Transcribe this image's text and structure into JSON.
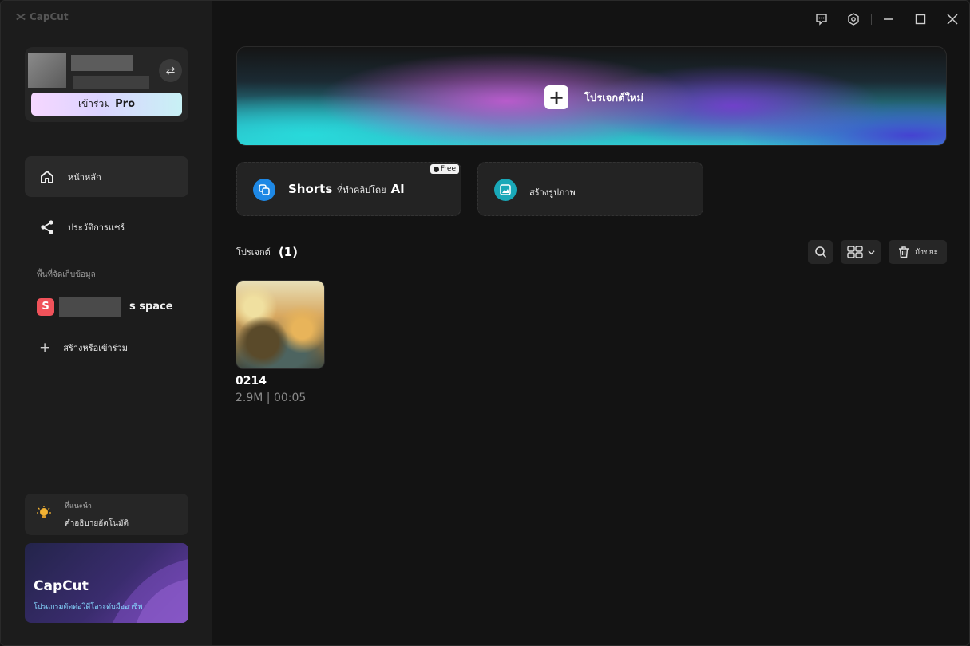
{
  "app": {
    "title": "CapCut"
  },
  "account": {
    "switch_icon": "swap-icon",
    "pro_prefix": "เข้าร่วม",
    "pro_word": "Pro"
  },
  "nav": [
    {
      "label": "หน้าหลัก",
      "icon": "home-icon",
      "active": true
    },
    {
      "label": "ประวัติการแชร์",
      "icon": "share-icon",
      "active": false
    }
  ],
  "storage": {
    "section_label": "พื้นที่จัดเก็บข้อมูล",
    "space_initial": "S",
    "space_suffix": "s space",
    "create_label": "สร้างหรือเข้าร่วม"
  },
  "tip": {
    "title": "ที่แนะนำ",
    "text": "คำอธิบายอัตโนมัติ"
  },
  "promo": {
    "title": "CapCut",
    "subtitle": "โปรแกรมตัดต่อวิดีโอระดับมืออาชีพ"
  },
  "hero": {
    "label": "โปรเจกต์ใหม่"
  },
  "features": [
    {
      "title": "Shorts",
      "subtitle": "ที่ทำคลิปโดย",
      "suffix": "AI",
      "badge": "Free",
      "icon": "shorts-ai-icon",
      "color": "#1e88e5"
    },
    {
      "title": "",
      "subtitle": "สร้างรูปภาพ",
      "suffix": "",
      "badge": "",
      "icon": "image-icon",
      "color": "#19a8b8"
    }
  ],
  "projects_header": {
    "label": "โปรเจกต์",
    "count": "(1)"
  },
  "toolbar": {
    "trash_label": "ถังขยะ"
  },
  "projects": [
    {
      "name": "0214",
      "meta": "2.9M | 00:05"
    }
  ],
  "colors": {
    "accent_pink": "#f0525a",
    "hero_cyan": "#30c9d0",
    "hero_purple": "#7a3ed2"
  }
}
